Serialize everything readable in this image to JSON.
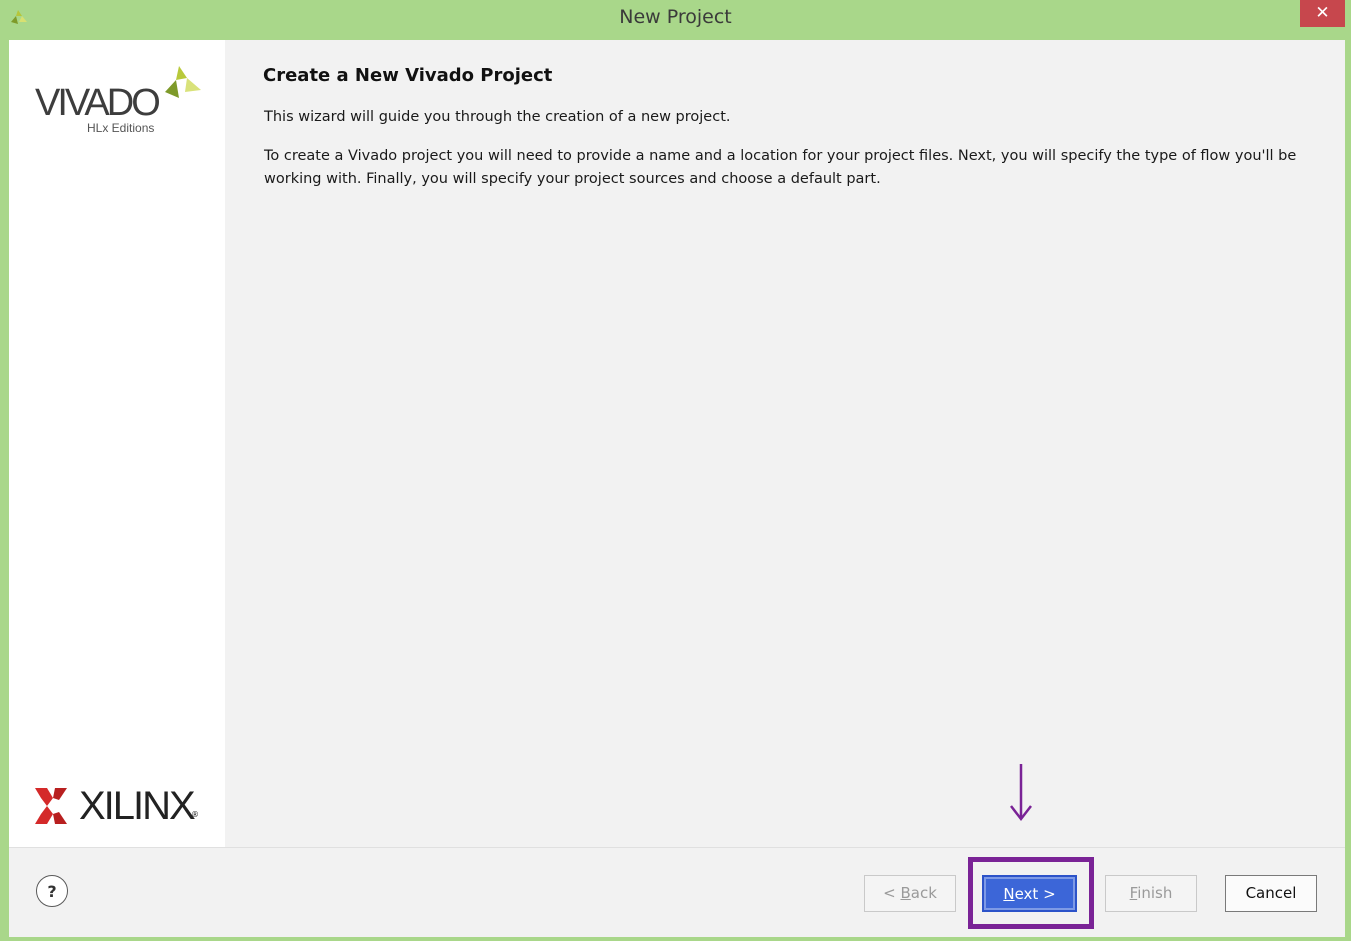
{
  "window": {
    "title": "New Project",
    "close_glyph": "✕",
    "app_icon": "vivado-app-icon"
  },
  "sidebar": {
    "vivado_logo_text": "VIVADO",
    "vivado_logo_subtitle": "HLx Editions",
    "xilinx_logo_text": "XILINX"
  },
  "content": {
    "heading": "Create a New Vivado Project",
    "paragraph1": "This wizard will guide you through the creation of a new project.",
    "paragraph2": "To create a Vivado project you will need to provide a name and a location for your project files. Next, you will specify the type of flow you'll be working with. Finally, you will specify your project sources and choose a default part."
  },
  "footer": {
    "help_label": "?",
    "back_prefix": "< ",
    "back_mnemonic": "B",
    "back_rest": "ack",
    "next_mnemonic": "N",
    "next_rest": "ext >",
    "finish_mnemonic": "F",
    "finish_rest": "inish",
    "cancel_label": "Cancel"
  },
  "annotation": {
    "highlight_color": "#7a2396",
    "arrow_color": "#7a2396"
  },
  "colors": {
    "window_frame": "#a9d78a",
    "close_button": "#c7474d",
    "next_button": "#3c66d8"
  }
}
